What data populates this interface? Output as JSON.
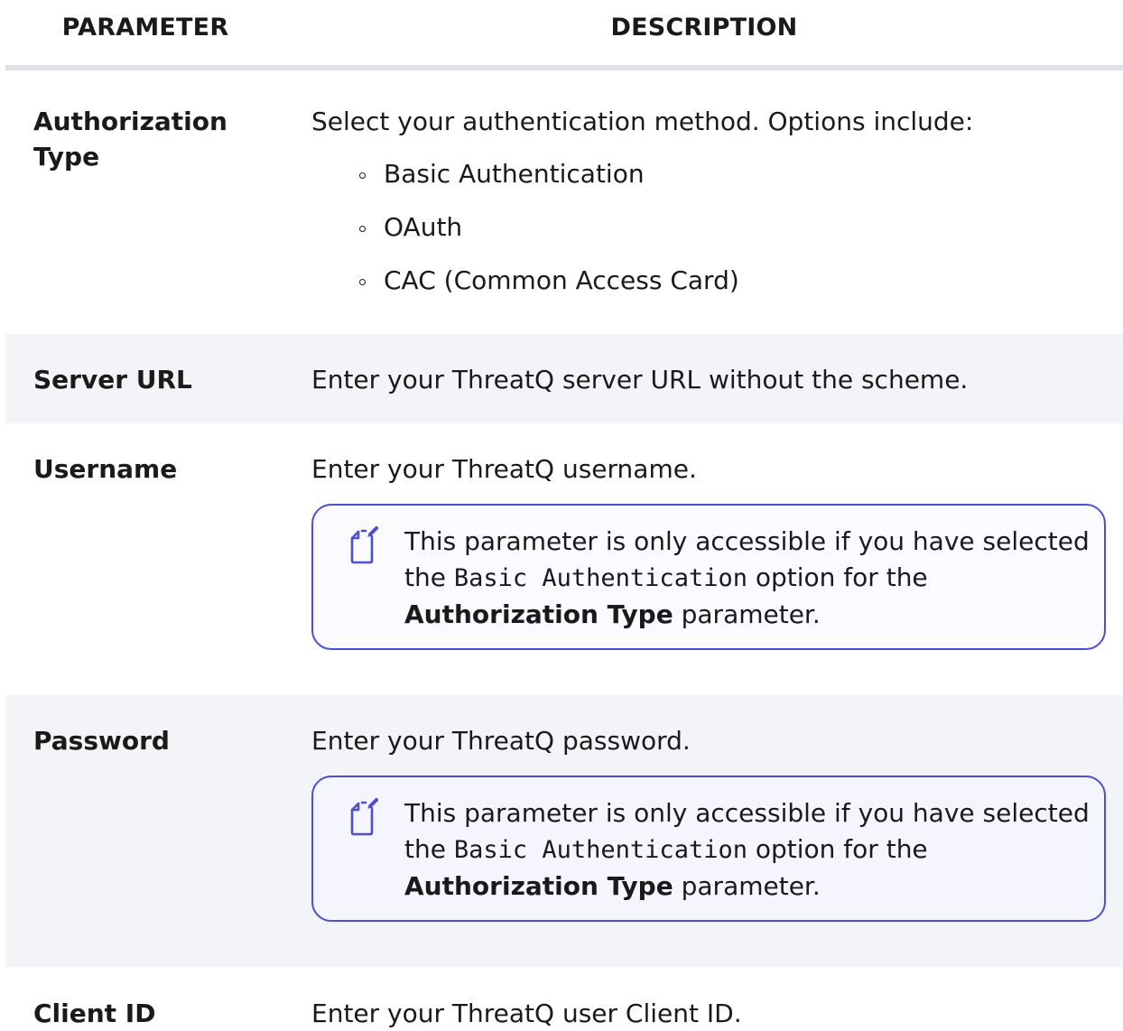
{
  "header": {
    "parameter": "PARAMETER",
    "description": "DESCRIPTION"
  },
  "rows": [
    {
      "param": "Authorization Type",
      "desc": "Select your authentication method. Options include:",
      "options": [
        "Basic Authentication",
        "OAuth",
        "CAC (Common Access Card)"
      ]
    },
    {
      "param": "Server URL",
      "desc": "Enter your ThreatQ server URL without the scheme."
    },
    {
      "param": "Username",
      "desc": "Enter your ThreatQ username.",
      "note": {
        "pre": "This parameter is only accessible if you have selected the ",
        "code": "Basic Authentication",
        "mid": " option for the ",
        "bold": "Authorization Type",
        "post": " parameter."
      }
    },
    {
      "param": "Password",
      "desc": "Enter your ThreatQ password.",
      "note": {
        "pre": "This parameter is only accessible if you have selected the ",
        "code": "Basic Authentication",
        "mid": " option for the ",
        "bold": "Authorization Type",
        "post": " parameter."
      }
    },
    {
      "param": "Client ID",
      "desc": "Enter your ThreatQ user Client ID."
    }
  ],
  "colors": {
    "note_border": "#4b4fd0",
    "alt_row_bg": "#f3f4f8",
    "header_rule": "#dfe1e7"
  },
  "icons": {
    "note": "note-pencil-icon",
    "bullet": "hollow-circle-bullet"
  }
}
